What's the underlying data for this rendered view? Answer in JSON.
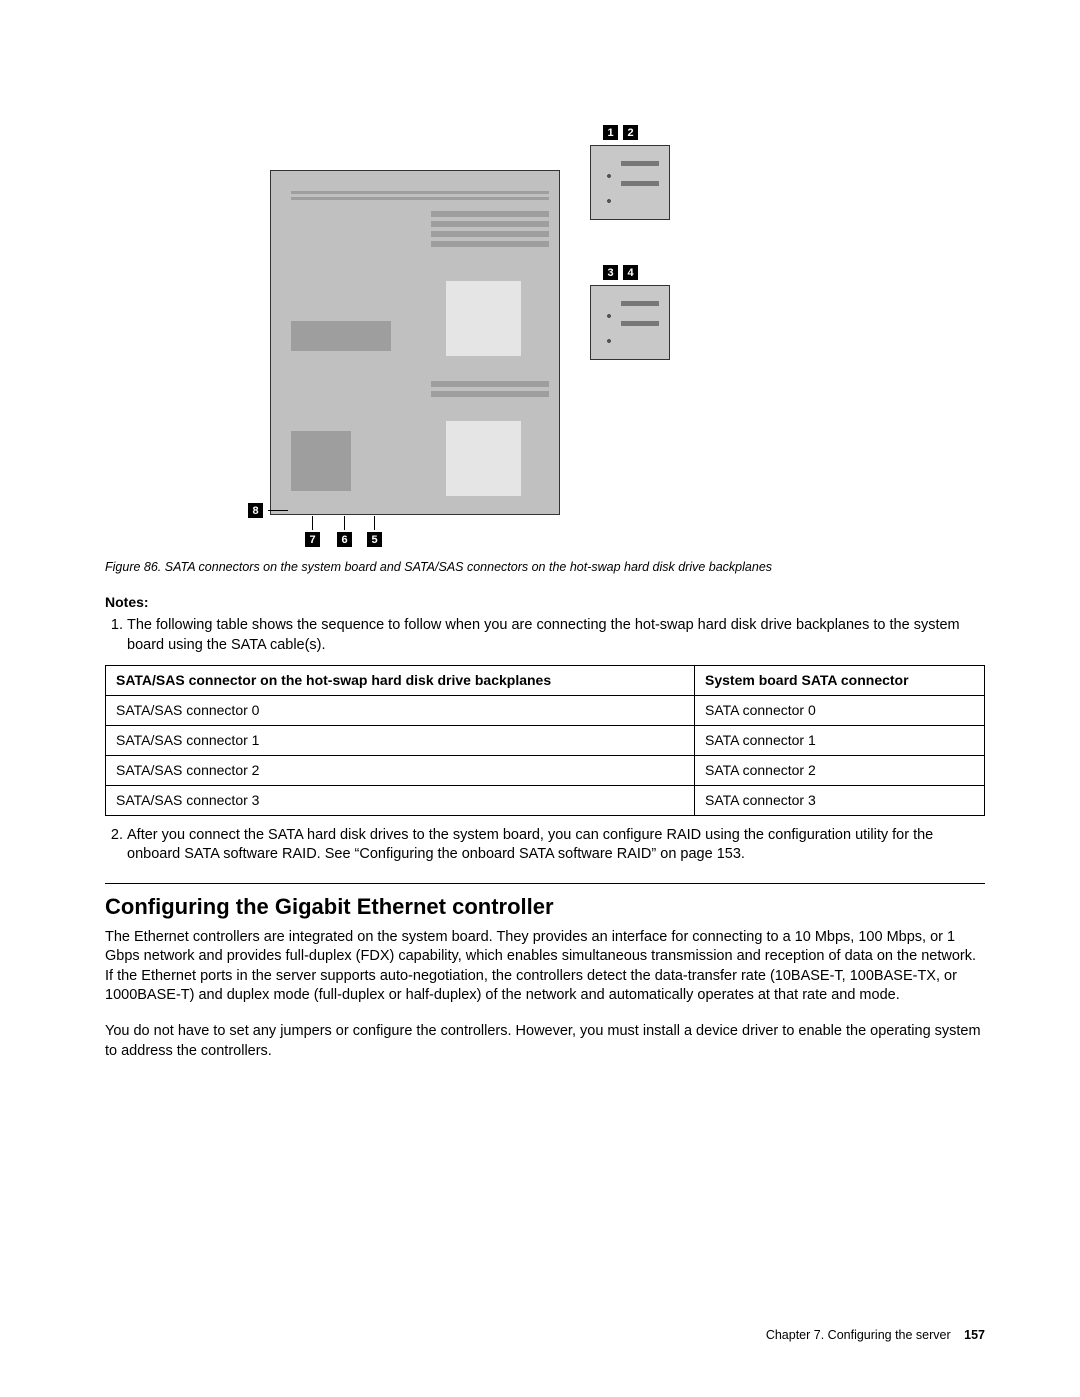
{
  "figure": {
    "labels": {
      "n1": "1",
      "n2": "2",
      "n3": "3",
      "n4": "4",
      "n5": "5",
      "n6": "6",
      "n7": "7",
      "n8": "8"
    },
    "caption": "Figure 86. SATA connectors on the system board and SATA/SAS connectors on the hot-swap hard disk drive backplanes"
  },
  "notes_heading": "Notes:",
  "notes": {
    "item1": "The following table shows the sequence to follow when you are connecting the hot-swap hard disk drive backplanes to the system board using the SATA cable(s).",
    "item2": "After you connect the SATA hard disk drives to the system board, you can configure RAID using the configuration utility for the onboard SATA software RAID. See “Configuring the onboard SATA software RAID” on page 153."
  },
  "table": {
    "header1": "SATA/SAS connector on the hot-swap hard disk drive backplanes",
    "header2": "System board SATA connector",
    "rows": {
      "r1c1": "SATA/SAS connector 0",
      "r1c2": "SATA connector 0",
      "r2c1": "SATA/SAS connector 1",
      "r2c2": "SATA connector 1",
      "r3c1": "SATA/SAS connector 2",
      "r3c2": "SATA connector 2",
      "r4c1": "SATA/SAS connector 3",
      "r4c2": "SATA connector 3"
    }
  },
  "section": {
    "title": "Configuring the Gigabit Ethernet controller",
    "p1": "The Ethernet controllers are integrated on the system board. They provides an interface for connecting to a 10 Mbps, 100 Mbps, or 1 Gbps network and provides full-duplex (FDX) capability, which enables simultaneous transmission and reception of data on the network. If the Ethernet ports in the server supports auto-negotiation, the controllers detect the data-transfer rate (10BASE-T, 100BASE-TX, or 1000BASE-T) and duplex mode (full-duplex or half-duplex) of the network and automatically operates at that rate and mode.",
    "p2": "You do not have to set any jumpers or configure the controllers. However, you must install a device driver to enable the operating system to address the controllers."
  },
  "footer": {
    "chapter": "Chapter 7.  Configuring the server",
    "page": "157"
  }
}
